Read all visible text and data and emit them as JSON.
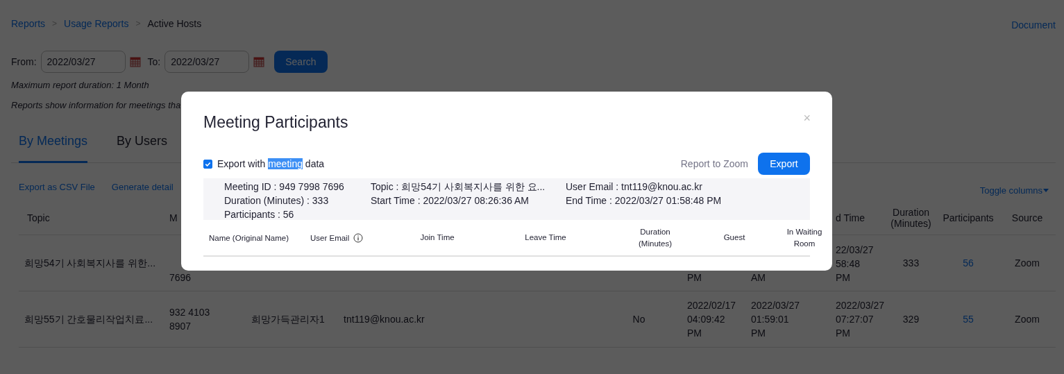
{
  "breadcrumb": {
    "items": [
      {
        "label": "Reports",
        "kind": "link"
      },
      {
        "label": "Usage Reports",
        "kind": "link"
      },
      {
        "label": "Active Hosts",
        "kind": "current"
      }
    ],
    "separators": [
      ">",
      ">"
    ],
    "doc_link": "Document"
  },
  "filter": {
    "from_label": "From:",
    "from_value": "2022/03/27",
    "to_label": "To:",
    "to_value": "2022/03/27",
    "search_button": "Search",
    "note": "Maximum report duration: 1 Month",
    "info": "Reports show information for meetings tha"
  },
  "tabs": [
    {
      "label": "By Meetings",
      "selected": true
    },
    {
      "label": "By Users",
      "selected": false
    }
  ],
  "actions": [
    "Export as CSV File",
    "Generate detail"
  ],
  "toggle_columns": "Toggle columns",
  "table": {
    "columns": [
      "Topic",
      "M",
      null,
      null,
      null,
      null,
      null,
      "d Time",
      "Duration (Minutes)",
      "Participants",
      "Source"
    ],
    "rows": [
      [
        {
          "kind": "text",
          "lines": [
            "희망54기 사회복지사를 위한..."
          ]
        },
        {
          "kind": "partial",
          "lines": [
            "7696"
          ]
        },
        null,
        null,
        null,
        {
          "kind": "partial",
          "lines": [
            "PM"
          ]
        },
        {
          "kind": "partial",
          "lines": [
            "AM"
          ]
        },
        {
          "kind": "partial",
          "lines": [
            "22/03/27",
            "58:48",
            "PM"
          ]
        },
        {
          "kind": "center",
          "lines": [
            "333"
          ]
        },
        {
          "kind": "link",
          "lines": [
            "56"
          ]
        },
        {
          "kind": "center",
          "lines": [
            "Zoom"
          ]
        }
      ],
      [
        {
          "kind": "text",
          "lines": [
            "희망55기 간호물리작업치료..."
          ]
        },
        {
          "kind": "text",
          "lines": [
            "932 4103",
            "8907"
          ]
        },
        {
          "kind": "text",
          "lines": [
            "희망가득관리자1"
          ]
        },
        {
          "kind": "text",
          "lines": [
            "tnt119@knou.ac.kr"
          ]
        },
        {
          "kind": "center",
          "lines": [
            "No"
          ]
        },
        {
          "kind": "text",
          "lines": [
            "2022/02/17",
            "04:09:42",
            "PM"
          ]
        },
        {
          "kind": "text",
          "lines": [
            "2022/03/27",
            "01:59:01",
            "PM"
          ]
        },
        {
          "kind": "text",
          "lines": [
            "2022/03/27",
            "07:27:07",
            "PM"
          ]
        },
        {
          "kind": "center",
          "lines": [
            "329"
          ]
        },
        {
          "kind": "link",
          "lines": [
            "55"
          ]
        },
        {
          "kind": "center",
          "lines": [
            "Zoom"
          ]
        }
      ]
    ]
  },
  "dialog": {
    "title": "Meeting Participants",
    "close": "×",
    "export_option": {
      "checked": true,
      "label_parts": [
        {
          "text": "Export with ",
          "highlighted": false
        },
        {
          "text": "meeting",
          "highlighted": true
        },
        {
          "text": " data",
          "highlighted": false
        }
      ]
    },
    "report_link": "Report to Zoom",
    "export_button": "Export",
    "info": [
      [
        "Meeting ID : 949 7998 7696",
        "Duration (Minutes) : 333",
        "Participants : 56"
      ],
      [
        "Topic : 희망54기 사회복지사를 위한 요...",
        "Start Time : 2022/03/27 08:26:36 AM"
      ],
      [
        "User Email : tnt119@knou.ac.kr",
        "End Time : 2022/03/27 01:58:48 PM"
      ]
    ],
    "columns": [
      {
        "label": "Name (Original Name)",
        "info": false
      },
      {
        "label": "User Email",
        "info": true
      },
      {
        "label": "Join Time",
        "info": false
      },
      {
        "label": "Leave Time",
        "info": false
      },
      {
        "label": "Duration (Minutes)",
        "info": false
      },
      {
        "label": "Guest",
        "info": false
      },
      {
        "label": "In Waiting Room",
        "info": false
      }
    ]
  }
}
